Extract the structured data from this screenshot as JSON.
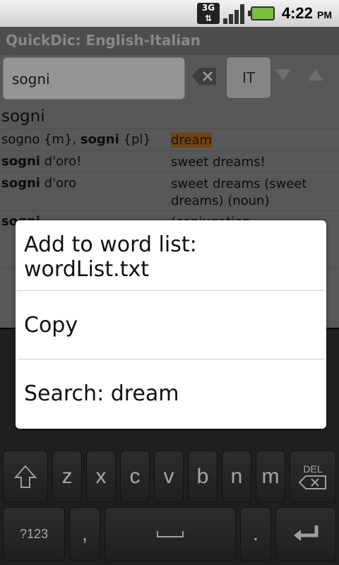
{
  "status_bar": {
    "network": "3G",
    "time": "4:22",
    "ampm": "PM",
    "icons": [
      "3g-data-icon",
      "signal-strength-icon",
      "battery-charging-icon"
    ]
  },
  "app": {
    "title": "QuickDic: English-Italian"
  },
  "search": {
    "value": "sogni",
    "language_button": "IT"
  },
  "results": {
    "header": "sogni",
    "rows": [
      {
        "left_bold": "",
        "left_pre": "sogno {m}, ",
        "left_boldword": "sogni",
        "left_post": " {pl}",
        "right": "dream"
      },
      {
        "left_boldword": "sogni",
        "left_post": " d'oro!",
        "right": "sweet dreams!"
      },
      {
        "left_boldword": "sogni",
        "left_post": " d'oro",
        "right": "sweet dreams (sweet dreams) (noun)"
      },
      {
        "left_boldword": "sogni",
        "left_post": "",
        "right": "(conjugation"
      }
    ]
  },
  "context_menu": {
    "items": [
      "Add to word list: wordList.txt",
      "Copy",
      "Search: dream"
    ]
  },
  "keyboard": {
    "row3": [
      "z",
      "x",
      "c",
      "v",
      "b",
      "n",
      "m"
    ],
    "del_label": "DEL",
    "symbols_label": "?123",
    "comma": ",",
    "period": "."
  }
}
